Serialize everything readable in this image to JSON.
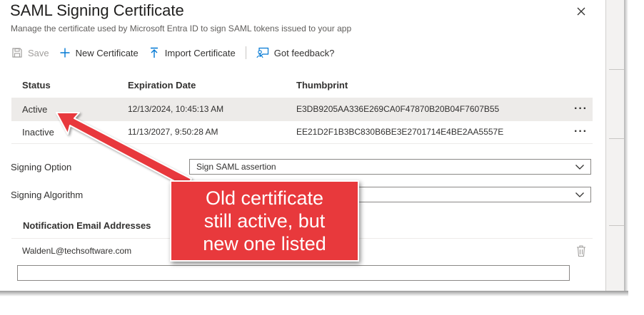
{
  "header": {
    "title": "SAML Signing Certificate",
    "subtitle": "Manage the certificate used by Microsoft Entra ID to sign SAML tokens issued to your app"
  },
  "toolbar": {
    "save_label": "Save",
    "new_certificate_label": "New Certificate",
    "import_certificate_label": "Import Certificate",
    "feedback_label": "Got feedback?"
  },
  "table": {
    "columns": [
      "Status",
      "Expiration Date",
      "Thumbprint"
    ],
    "rows": [
      {
        "status": "Active",
        "expiration": "12/13/2024, 10:45:13 AM",
        "thumbprint": "E3DB9205AA336E269CA0F47870B20B04F7607B55"
      },
      {
        "status": "Inactive",
        "expiration": "11/13/2027, 9:50:28 AM",
        "thumbprint": "EE21D2F1B3BC830B6BE3E2701714E4BE2AA5557E"
      }
    ]
  },
  "form": {
    "signing_option_label": "Signing Option",
    "signing_option_value": "Sign SAML assertion",
    "signing_algorithm_label": "Signing Algorithm",
    "signing_algorithm_value": ""
  },
  "notifications": {
    "header": "Notification Email Addresses",
    "emails": [
      "WaldenL@techsoftware.com"
    ],
    "new_email_value": ""
  },
  "annotation": {
    "lines": [
      "Old certificate",
      "still active, but",
      "new one listed"
    ],
    "color": "#e8393c"
  }
}
